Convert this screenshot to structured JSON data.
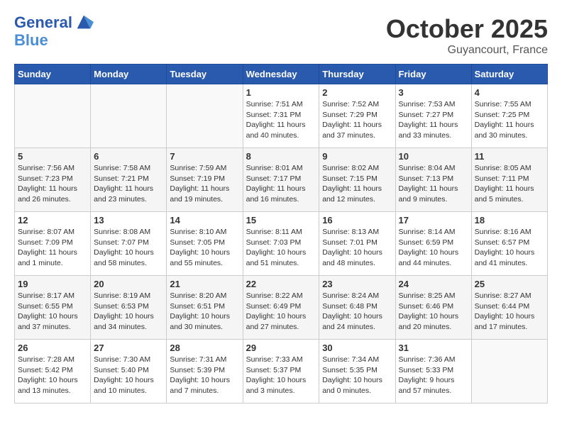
{
  "header": {
    "logo_line1": "General",
    "logo_line2": "Blue",
    "month": "October 2025",
    "location": "Guyancourt, France"
  },
  "days_of_week": [
    "Sunday",
    "Monday",
    "Tuesday",
    "Wednesday",
    "Thursday",
    "Friday",
    "Saturday"
  ],
  "weeks": [
    [
      {
        "num": "",
        "info": ""
      },
      {
        "num": "",
        "info": ""
      },
      {
        "num": "",
        "info": ""
      },
      {
        "num": "1",
        "info": "Sunrise: 7:51 AM\nSunset: 7:31 PM\nDaylight: 11 hours and 40 minutes."
      },
      {
        "num": "2",
        "info": "Sunrise: 7:52 AM\nSunset: 7:29 PM\nDaylight: 11 hours and 37 minutes."
      },
      {
        "num": "3",
        "info": "Sunrise: 7:53 AM\nSunset: 7:27 PM\nDaylight: 11 hours and 33 minutes."
      },
      {
        "num": "4",
        "info": "Sunrise: 7:55 AM\nSunset: 7:25 PM\nDaylight: 11 hours and 30 minutes."
      }
    ],
    [
      {
        "num": "5",
        "info": "Sunrise: 7:56 AM\nSunset: 7:23 PM\nDaylight: 11 hours and 26 minutes."
      },
      {
        "num": "6",
        "info": "Sunrise: 7:58 AM\nSunset: 7:21 PM\nDaylight: 11 hours and 23 minutes."
      },
      {
        "num": "7",
        "info": "Sunrise: 7:59 AM\nSunset: 7:19 PM\nDaylight: 11 hours and 19 minutes."
      },
      {
        "num": "8",
        "info": "Sunrise: 8:01 AM\nSunset: 7:17 PM\nDaylight: 11 hours and 16 minutes."
      },
      {
        "num": "9",
        "info": "Sunrise: 8:02 AM\nSunset: 7:15 PM\nDaylight: 11 hours and 12 minutes."
      },
      {
        "num": "10",
        "info": "Sunrise: 8:04 AM\nSunset: 7:13 PM\nDaylight: 11 hours and 9 minutes."
      },
      {
        "num": "11",
        "info": "Sunrise: 8:05 AM\nSunset: 7:11 PM\nDaylight: 11 hours and 5 minutes."
      }
    ],
    [
      {
        "num": "12",
        "info": "Sunrise: 8:07 AM\nSunset: 7:09 PM\nDaylight: 11 hours and 1 minute."
      },
      {
        "num": "13",
        "info": "Sunrise: 8:08 AM\nSunset: 7:07 PM\nDaylight: 10 hours and 58 minutes."
      },
      {
        "num": "14",
        "info": "Sunrise: 8:10 AM\nSunset: 7:05 PM\nDaylight: 10 hours and 55 minutes."
      },
      {
        "num": "15",
        "info": "Sunrise: 8:11 AM\nSunset: 7:03 PM\nDaylight: 10 hours and 51 minutes."
      },
      {
        "num": "16",
        "info": "Sunrise: 8:13 AM\nSunset: 7:01 PM\nDaylight: 10 hours and 48 minutes."
      },
      {
        "num": "17",
        "info": "Sunrise: 8:14 AM\nSunset: 6:59 PM\nDaylight: 10 hours and 44 minutes."
      },
      {
        "num": "18",
        "info": "Sunrise: 8:16 AM\nSunset: 6:57 PM\nDaylight: 10 hours and 41 minutes."
      }
    ],
    [
      {
        "num": "19",
        "info": "Sunrise: 8:17 AM\nSunset: 6:55 PM\nDaylight: 10 hours and 37 minutes."
      },
      {
        "num": "20",
        "info": "Sunrise: 8:19 AM\nSunset: 6:53 PM\nDaylight: 10 hours and 34 minutes."
      },
      {
        "num": "21",
        "info": "Sunrise: 8:20 AM\nSunset: 6:51 PM\nDaylight: 10 hours and 30 minutes."
      },
      {
        "num": "22",
        "info": "Sunrise: 8:22 AM\nSunset: 6:49 PM\nDaylight: 10 hours and 27 minutes."
      },
      {
        "num": "23",
        "info": "Sunrise: 8:24 AM\nSunset: 6:48 PM\nDaylight: 10 hours and 24 minutes."
      },
      {
        "num": "24",
        "info": "Sunrise: 8:25 AM\nSunset: 6:46 PM\nDaylight: 10 hours and 20 minutes."
      },
      {
        "num": "25",
        "info": "Sunrise: 8:27 AM\nSunset: 6:44 PM\nDaylight: 10 hours and 17 minutes."
      }
    ],
    [
      {
        "num": "26",
        "info": "Sunrise: 7:28 AM\nSunset: 5:42 PM\nDaylight: 10 hours and 13 minutes."
      },
      {
        "num": "27",
        "info": "Sunrise: 7:30 AM\nSunset: 5:40 PM\nDaylight: 10 hours and 10 minutes."
      },
      {
        "num": "28",
        "info": "Sunrise: 7:31 AM\nSunset: 5:39 PM\nDaylight: 10 hours and 7 minutes."
      },
      {
        "num": "29",
        "info": "Sunrise: 7:33 AM\nSunset: 5:37 PM\nDaylight: 10 hours and 3 minutes."
      },
      {
        "num": "30",
        "info": "Sunrise: 7:34 AM\nSunset: 5:35 PM\nDaylight: 10 hours and 0 minutes."
      },
      {
        "num": "31",
        "info": "Sunrise: 7:36 AM\nSunset: 5:33 PM\nDaylight: 9 hours and 57 minutes."
      },
      {
        "num": "",
        "info": ""
      }
    ]
  ]
}
